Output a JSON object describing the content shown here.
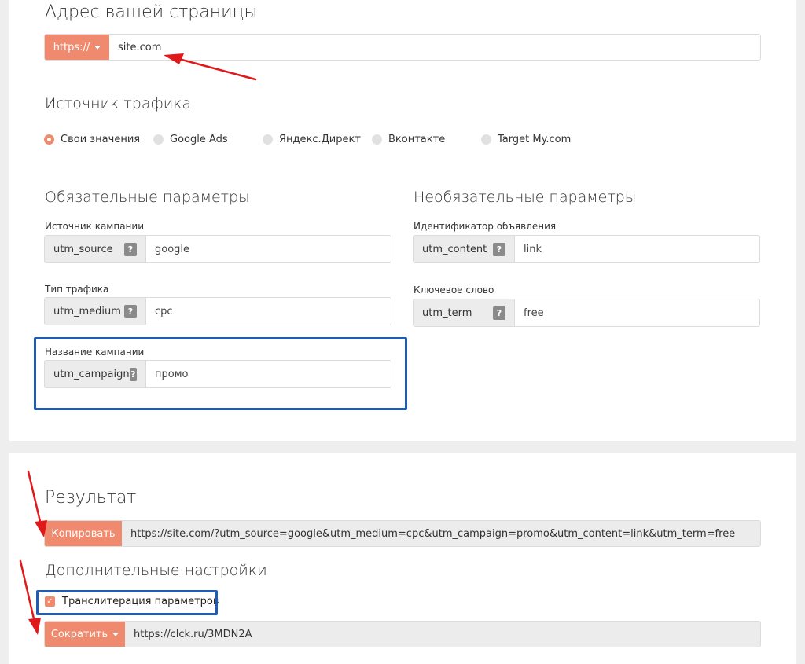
{
  "address": {
    "title": "Адрес вашей страницы",
    "protocol_label": "https://",
    "url_value": "site.com"
  },
  "traffic_source": {
    "title": "Источник трафика",
    "options": [
      {
        "label": "Свои значения",
        "selected": true
      },
      {
        "label": "Google Ads",
        "selected": false
      },
      {
        "label": "Яндекс.Директ",
        "selected": false
      },
      {
        "label": "Вконтакте",
        "selected": false
      },
      {
        "label": "Target My.com",
        "selected": false
      }
    ]
  },
  "required": {
    "title": "Обязательные параметры",
    "fields": [
      {
        "label": "Источник кампании",
        "param": "utm_source",
        "value": "google"
      },
      {
        "label": "Тип трафика",
        "param": "utm_medium",
        "value": "cpc"
      },
      {
        "label": "Название кампании",
        "param": "utm_campaign",
        "value": "промо"
      }
    ]
  },
  "optional": {
    "title": "Необязательные параметры",
    "fields": [
      {
        "label": "Идентификатор объявления",
        "param": "utm_content",
        "value": "link"
      },
      {
        "label": "Ключевое слово",
        "param": "utm_term",
        "value": "free"
      }
    ]
  },
  "help_glyph": "?",
  "result": {
    "title": "Результат",
    "copy_label": "Копировать",
    "url": "https://site.com/?utm_source=google&utm_medium=cpc&utm_campaign=promo&utm_content=link&utm_term=free"
  },
  "extra": {
    "title": "Дополнительные настройки",
    "transliteration_label": "Транслитерация параметров",
    "transliteration_checked": true,
    "shorten_label": "Сократить",
    "short_url": "https://clck.ru/3MDN2A"
  },
  "colors": {
    "accent": "#ef8a6e",
    "annotation_blue": "#1f5cb8",
    "annotation_red": "#e01a1a",
    "page_bg": "#eeeeee"
  }
}
